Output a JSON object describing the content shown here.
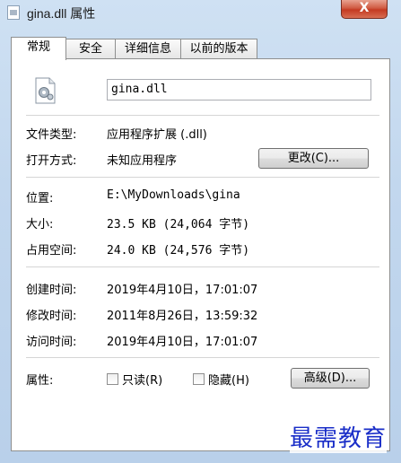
{
  "window": {
    "title": "gina.dll 属性",
    "close_glyph": "X"
  },
  "tabs": [
    {
      "label": "常规",
      "active": true
    },
    {
      "label": "安全",
      "active": false
    },
    {
      "label": "详细信息",
      "active": false
    },
    {
      "label": "以前的版本",
      "active": false
    }
  ],
  "general": {
    "file_name": "gina.dll",
    "file_type_label": "文件类型:",
    "file_type_value": "应用程序扩展 (.dll)",
    "opens_with_label": "打开方式:",
    "opens_with_value": "未知应用程序",
    "change_button": "更改(C)...",
    "location_label": "位置:",
    "location_value": "E:\\MyDownloads\\gina",
    "size_label": "大小:",
    "size_value": "23.5 KB (24,064 字节)",
    "size_on_disk_label": "占用空间:",
    "size_on_disk_value": "24.0 KB (24,576 字节)",
    "created_label": "创建时间:",
    "created_value": "2019年4月10日，17:01:07",
    "modified_label": "修改时间:",
    "modified_value": "2011年8月26日，13:59:32",
    "accessed_label": "访问时间:",
    "accessed_value": "2019年4月10日，17:01:07",
    "attributes_label": "属性:",
    "readonly_label": "只读(R)",
    "readonly_checked": false,
    "hidden_label": "隐藏(H)",
    "hidden_checked": false,
    "advanced_button": "高级(D)..."
  },
  "watermark": "最需教育",
  "colors": {
    "close_button": "#c43a22",
    "watermark": "#1a2ec8"
  }
}
